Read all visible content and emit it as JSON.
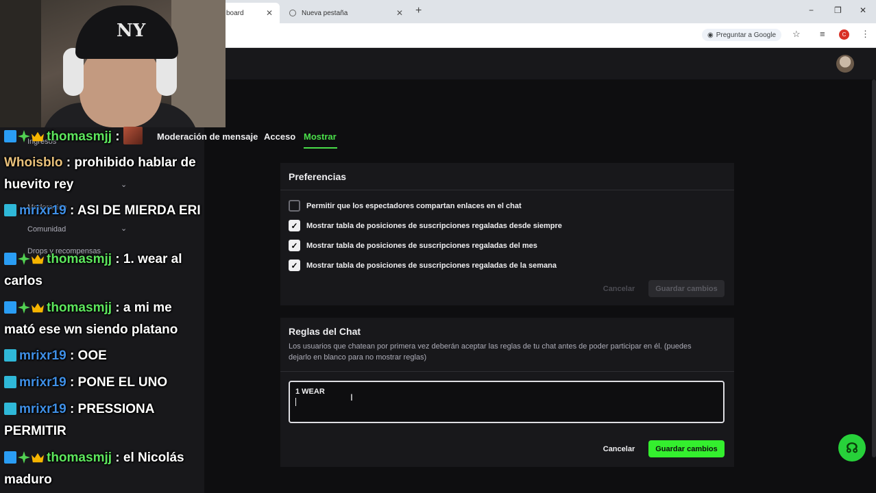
{
  "browser": {
    "tabs": [
      {
        "label": "board",
        "close": "✕"
      },
      {
        "label": "Nueva pestaña",
        "close": "✕"
      }
    ],
    "new_tab": "+",
    "window_controls": [
      "−",
      "❐",
      "✕"
    ],
    "ask_google": "Preguntar a Google",
    "profile_initial": "C"
  },
  "sidebar": {
    "items": [
      {
        "label": "Ingresos"
      },
      {
        "label": "Moderación"
      },
      {
        "label": "Comunidad"
      },
      {
        "label": "Drops y recompensas"
      }
    ]
  },
  "nav_tabs": [
    {
      "label": "Moderación de mensaje"
    },
    {
      "label": "Acceso"
    },
    {
      "label": "Mostrar"
    }
  ],
  "preferencias": {
    "title": "Preferencias",
    "options": [
      {
        "label": "Permitir que los espectadores compartan enlaces en el chat",
        "checked": false
      },
      {
        "label": "Mostrar tabla de posiciones de suscripciones regaladas desde siempre",
        "checked": true
      },
      {
        "label": "Mostrar tabla de posiciones de suscripciones regaladas del mes",
        "checked": true
      },
      {
        "label": "Mostrar tabla de posiciones de suscripciones regaladas de la semana",
        "checked": true
      }
    ],
    "cancel_label": "Cancelar",
    "save_label": "Guardar cambios"
  },
  "reglas": {
    "title": "Reglas del Chat",
    "description": "Los usuarios que chatean por primera vez deberán aceptar las reglas de tu chat antes de poder participar en él. (puedes dejarlo en blanco para no mostrar reglas)",
    "value": "1 WEAR",
    "cancel_label": "Cancelar",
    "save_label": "Guardar cambios"
  },
  "webcam": {
    "cap_logo": "NY"
  },
  "chat": {
    "messages": [
      {
        "user": "thomasmjj",
        "text": " : ",
        "color": "green",
        "badges": [
          "blue",
          "green",
          "gold"
        ],
        "emote": true
      },
      {
        "user": "Whoisblo",
        "text": " : prohibido hablar de huevito rey",
        "color": "tan",
        "badges": []
      },
      {
        "user": "mrixr19",
        "text": " : ASI DE MIERDA ERI",
        "color": "blue",
        "badges": [
          "grid"
        ]
      },
      {
        "user": "thomasmjj",
        "text": " : 1. wear al carlos",
        "color": "green",
        "badges": [
          "blue",
          "green",
          "gold"
        ]
      },
      {
        "user": "thomasmjj",
        "text": " : a mi me mató ese wn siendo platano",
        "color": "green",
        "badges": [
          "blue",
          "green",
          "gold"
        ]
      },
      {
        "user": "mrixr19",
        "text": " : OOE",
        "color": "blue",
        "badges": [
          "grid"
        ]
      },
      {
        "user": "mrixr19",
        "text": " : PONE EL UNO",
        "color": "blue",
        "badges": [
          "grid"
        ]
      },
      {
        "user": "mrixr19",
        "text": " : PRESSIONA PERMITIR",
        "color": "blue",
        "badges": [
          "grid"
        ]
      },
      {
        "user": "thomasmjj",
        "text": " : el Nicolás maduro",
        "color": "green",
        "badges": [
          "blue",
          "green",
          "gold"
        ]
      }
    ]
  },
  "colors": {
    "accent": "#4ae04a",
    "button_green": "#34ef2e",
    "page_bg": "#0e0e10",
    "card_bg": "#18181b"
  }
}
